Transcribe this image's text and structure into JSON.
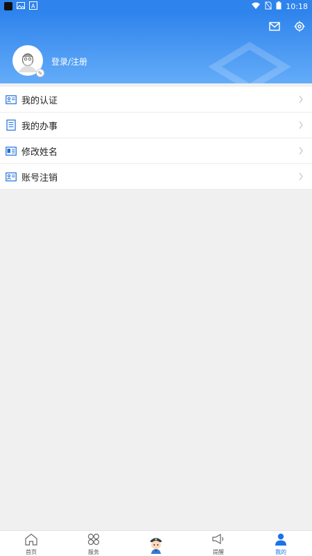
{
  "status_bar": {
    "time": "10:18",
    "icons": [
      "app-icon",
      "gallery-icon",
      "text-icon",
      "wifi-icon",
      "no-sim-icon",
      "battery-icon"
    ]
  },
  "header": {
    "login_text": "登录/注册",
    "actions": [
      "mail-icon",
      "settings-icon"
    ]
  },
  "menu": {
    "items": [
      {
        "label": "我的认证",
        "icon": "id-card-icon"
      },
      {
        "label": "我的办事",
        "icon": "document-icon"
      },
      {
        "label": "修改姓名",
        "icon": "id-card-icon"
      },
      {
        "label": "账号注销",
        "icon": "id-card-icon"
      }
    ]
  },
  "bottom_nav": {
    "items": [
      {
        "label": "首页",
        "icon": "home-icon"
      },
      {
        "label": "服务",
        "icon": "apps-icon"
      },
      {
        "label": "",
        "icon": "police-avatar-icon"
      },
      {
        "label": "提醒",
        "icon": "megaphone-icon"
      },
      {
        "label": "我的",
        "icon": "user-icon",
        "active": true
      }
    ]
  },
  "colors": {
    "primary": "#2e83ec",
    "header_bottom": "#64acf9",
    "icon": "#1e6fd9",
    "background": "#f0f0f0"
  }
}
